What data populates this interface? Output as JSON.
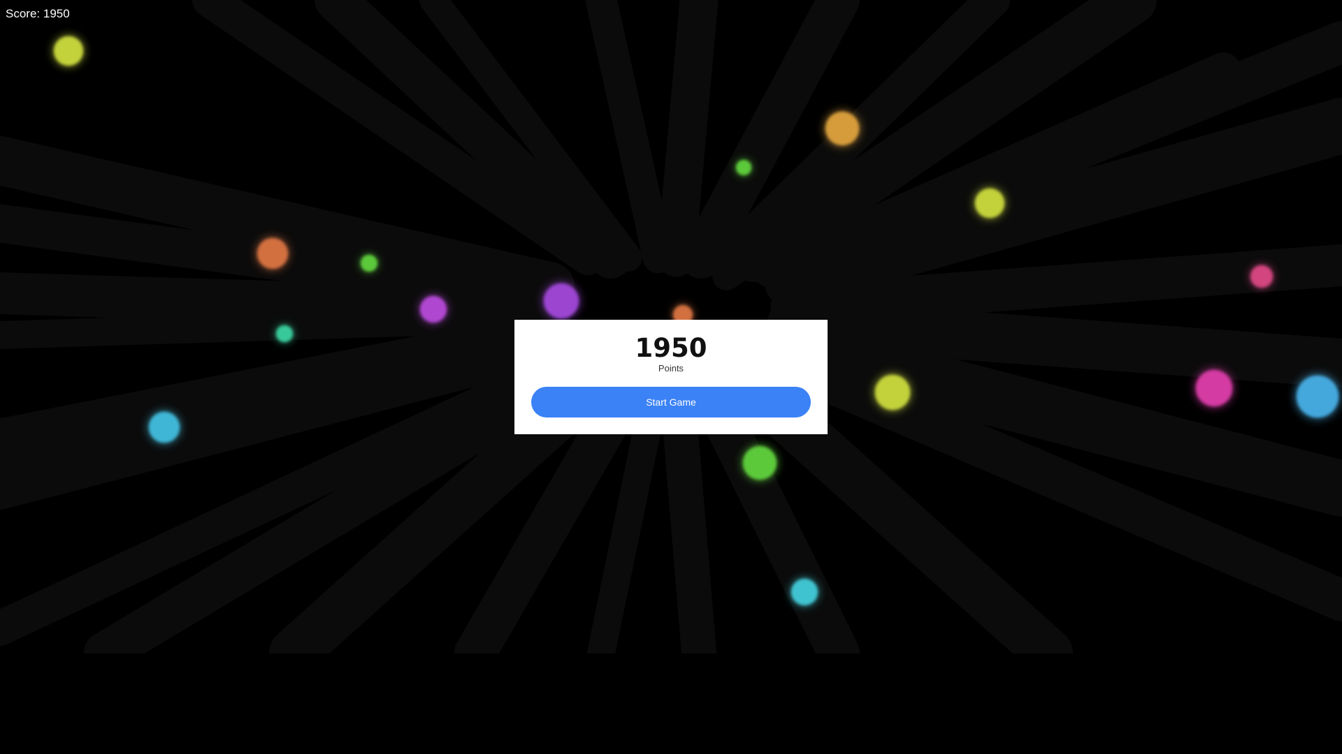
{
  "hud": {
    "score_label": "Score:",
    "score_value": "1950"
  },
  "panel": {
    "score": "1950",
    "label": "Points",
    "button_label": "Start Game"
  },
  "colors": {
    "background": "#000000",
    "panel": "#ffffff",
    "button": "#3b82f6",
    "streak": "#0c0c0c",
    "glow_palette": [
      "#c3d13a",
      "#d69c3a",
      "#5cc93a",
      "#d2703f",
      "#9b45d1",
      "#b047d1",
      "#38c99a",
      "#3fb6d6",
      "#d2457f",
      "#d43ba3",
      "#44a8dd",
      "#40c3d0"
    ]
  }
}
